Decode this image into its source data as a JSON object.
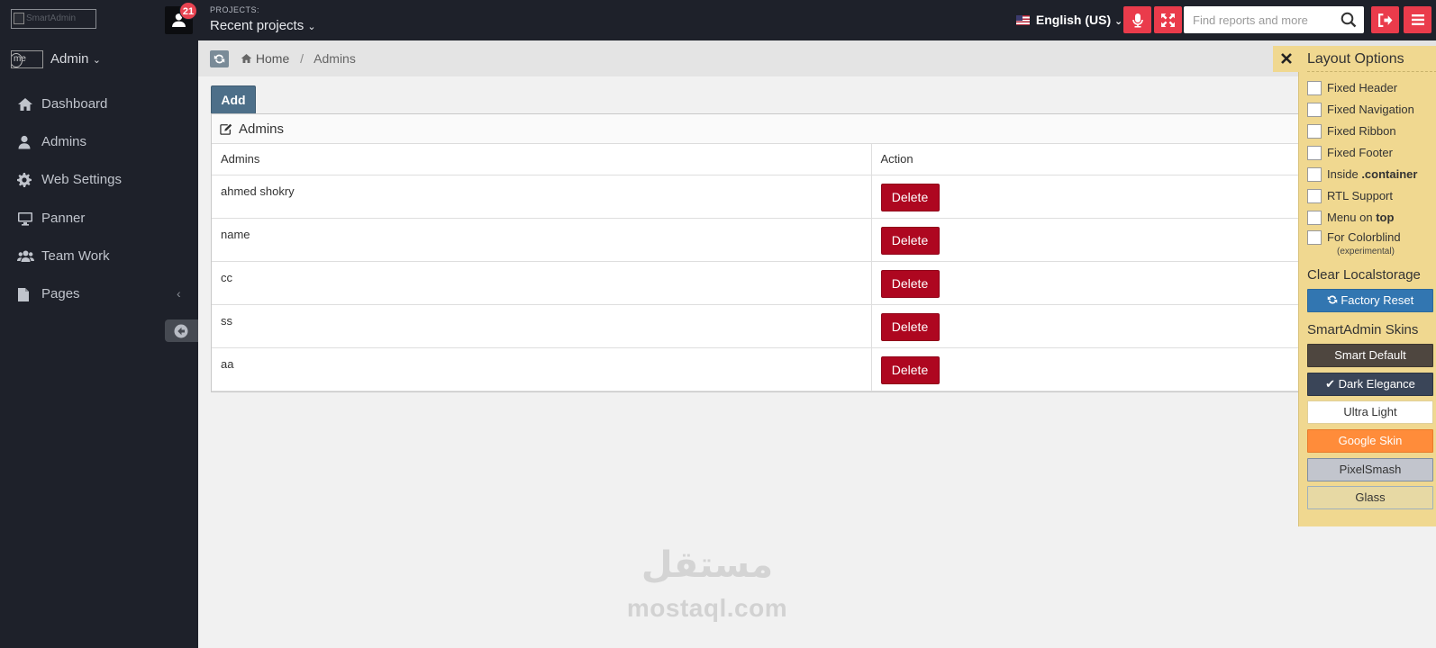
{
  "header": {
    "logo_alt": "SmartAdmin",
    "notification_count": "21",
    "projects_label": "PROJECTS:",
    "projects_value": "Recent projects",
    "language": "English (US)",
    "search_placeholder": "Find reports and more"
  },
  "sidebar": {
    "avatar_alt": "me",
    "user_name": "Admin",
    "items": [
      {
        "label": "Dashboard",
        "icon": "home-icon"
      },
      {
        "label": "Admins",
        "icon": "user-icon"
      },
      {
        "label": "Web Settings",
        "icon": "gear-icon"
      },
      {
        "label": "Panner",
        "icon": "desktop-icon"
      },
      {
        "label": "Team Work",
        "icon": "group-icon"
      },
      {
        "label": "Pages",
        "icon": "file-icon"
      }
    ]
  },
  "breadcrumb": {
    "home": "Home",
    "current": "Admins"
  },
  "main": {
    "add_label": "Add",
    "panel_title": "Admins",
    "columns": [
      "Admins",
      "Action"
    ],
    "rows": [
      {
        "name": "ahmed shokry",
        "action": "Delete"
      },
      {
        "name": "name",
        "action": "Delete"
      },
      {
        "name": "cc",
        "action": "Delete"
      },
      {
        "name": "ss",
        "action": "Delete"
      },
      {
        "name": "aa",
        "action": "Delete"
      }
    ]
  },
  "layout_options": {
    "title": "Layout Options",
    "options": [
      {
        "pre": "Fixed Header",
        "strong": "",
        "post": "",
        "checked": false
      },
      {
        "pre": "Fixed Navigation",
        "strong": "",
        "post": "",
        "checked": false
      },
      {
        "pre": "Fixed Ribbon",
        "strong": "",
        "post": "",
        "checked": false
      },
      {
        "pre": "Fixed Footer",
        "strong": "",
        "post": "",
        "checked": false
      },
      {
        "pre": "Inside ",
        "strong": ".container",
        "post": "",
        "checked": false
      },
      {
        "pre": "RTL Support",
        "strong": "",
        "post": "",
        "checked": false
      },
      {
        "pre": "Menu on ",
        "strong": "top",
        "post": "",
        "checked": false
      },
      {
        "pre": "For Colorblind",
        "strong": "",
        "post": "",
        "checked": false
      }
    ],
    "colorblind_note": "(experimental)",
    "clear_heading": "Clear Localstorage",
    "factory_reset": "Factory Reset",
    "skins_heading": "SmartAdmin Skins",
    "skins": [
      {
        "label": "Smart Default",
        "bg": "#4e463f",
        "fg": "#ffffff",
        "border": "#3e3730",
        "selected": false
      },
      {
        "label": "Dark Elegance",
        "bg": "#3a4558",
        "fg": "#ffffff",
        "border": "#2c3544",
        "selected": true
      },
      {
        "label": "Ultra Light",
        "bg": "#ffffff",
        "fg": "#333333",
        "border": "#e0d09a",
        "selected": false
      },
      {
        "label": "Google Skin",
        "bg": "#ff8c3a",
        "fg": "#ffffff",
        "border": "#e87a2b",
        "selected": false
      },
      {
        "label": "PixelSmash",
        "bg": "#c2c5cd",
        "fg": "#333333",
        "border": "#7f8ea3",
        "selected": false
      },
      {
        "label": "Glass",
        "bg": "#e7d9a4",
        "fg": "#333333",
        "border": "#9fb0bc",
        "selected": false
      }
    ]
  },
  "watermark": {
    "arabic": "مستقل",
    "latin": "mostaql.com"
  },
  "colors": {
    "header_bg": "#1e212a",
    "alert_red": "#ea3b4b",
    "delete_red": "#ae0720",
    "add_blue": "#4d6f89",
    "factory_blue": "#3276b1",
    "layout_panel_bg": "#f0d890"
  }
}
